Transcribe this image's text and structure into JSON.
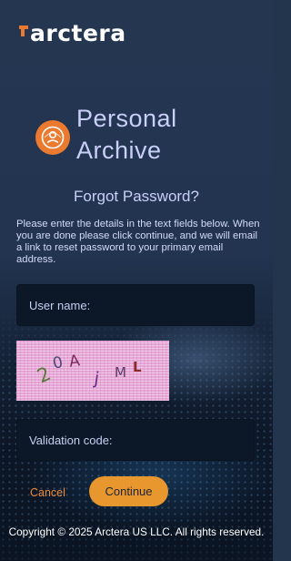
{
  "brand": {
    "logo_text": "arctera",
    "accent_color": "#ea7a2f"
  },
  "app": {
    "title_line1": "Personal",
    "title_line2": "Archive",
    "icon": "archive-user-icon"
  },
  "form": {
    "heading": "Forgot Password?",
    "instructions": "Please enter the details in the text fields below. When you are done please click continue, and we will email a link to reset password to your primary email address.",
    "username_placeholder": "User name:",
    "username_value": "",
    "captcha_text": "20AjML",
    "validation_placeholder": "Validation code:",
    "validation_value": "",
    "cancel_label": "Cancel",
    "continue_label": "Continue"
  },
  "footer": {
    "copyright": "Copyright © 2025 Arctera US LLC. All rights reserved."
  }
}
